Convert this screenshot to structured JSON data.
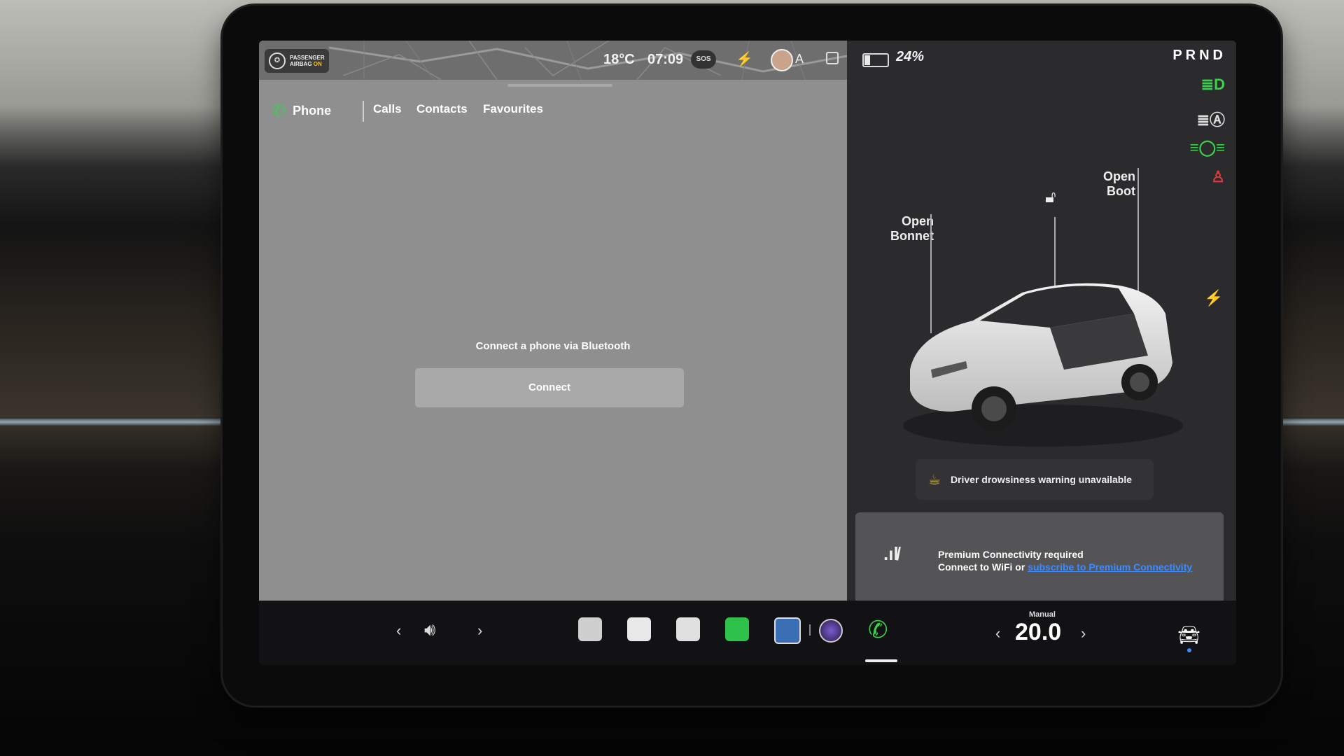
{
  "status_bar": {
    "airbag_line1": "PASSENGER",
    "airbag_line2": "AIRBAG",
    "airbag_state": "ON",
    "temperature": "18°C",
    "time": "07:09",
    "sos_label": "SOS",
    "profile_letter": "A"
  },
  "phone_app": {
    "title": "Phone",
    "tabs": [
      "Calls",
      "Contacts",
      "Favourites"
    ],
    "message": "Connect a phone via Bluetooth",
    "connect_label": "Connect"
  },
  "vehicle": {
    "battery_percent": "24%",
    "battery_level": 0.24,
    "gear": "PRND",
    "open_bonnet_line1": "Open",
    "open_bonnet_line2": "Bonnet",
    "open_boot_line1": "Open",
    "open_boot_line2": "Boot",
    "drowsiness_text": "Driver drowsiness warning unavailable",
    "premium_line1": "Premium Connectivity required",
    "premium_line2_prefix": "Connect to WiFi or ",
    "premium_link": "subscribe to Premium Connectivity"
  },
  "dock": {
    "climate_mode": "Manual",
    "temperature": "20.0"
  },
  "colors": {
    "accent_green": "#3ccf4e",
    "link_blue": "#3d8bff",
    "warning_red": "#e23b3b"
  }
}
